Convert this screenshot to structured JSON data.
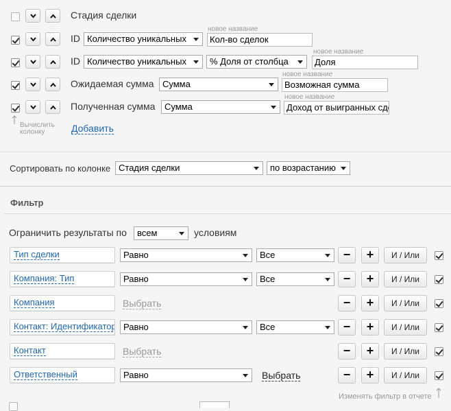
{
  "columns": {
    "rows": [
      {
        "checked": false,
        "label": "Стадия сделки"
      },
      {
        "checked": true,
        "label": "ID",
        "aggregate": "Количество уникальных",
        "hint": "новое название",
        "name": "Кол-во сделок"
      },
      {
        "checked": true,
        "label": "ID",
        "aggregate": "Количество уникальных",
        "extra": "% Доля от столбца",
        "hint": "новое название",
        "name": "Доля"
      },
      {
        "checked": true,
        "label": "Ожидаемая сумма",
        "aggregate": "Сумма",
        "hint": "новое название",
        "name": "Возможная сумма"
      },
      {
        "checked": true,
        "label": "Полученная сумма",
        "aggregate": "Сумма",
        "hint": "новое название",
        "name": "Доход от выигранных сделок"
      }
    ],
    "calc_hint_line1": "Вычислить",
    "calc_hint_line2": "колонку",
    "add_link": "Добавить"
  },
  "sort": {
    "label": "Сортировать по колонке",
    "column": "Стадия сделки",
    "order": "по возрастанию"
  },
  "filter": {
    "title": "Фильтр",
    "limit_label": "Ограничить результаты по",
    "limit_value": "всем",
    "limit_suffix": "условиям",
    "rows": [
      {
        "field": "Тип сделки",
        "op": "Равно",
        "value": "Все",
        "andor": "И / Или"
      },
      {
        "field": "Компания: Тип",
        "op": "Равно",
        "value": "Все",
        "andor": "И / Или"
      },
      {
        "field": "Компания",
        "choose": "Выбрать",
        "andor": "И / Или"
      },
      {
        "field": "Контакт: Идентификатор",
        "op": "Равно",
        "value": "Все",
        "andor": "И / Или"
      },
      {
        "field": "Контакт",
        "choose": "Выбрать",
        "andor": "И / Или"
      },
      {
        "field": "Ответственный",
        "op": "Равно",
        "choose": "Выбрать",
        "andor": "И / Или"
      }
    ],
    "minus": "−",
    "plus": "+",
    "change_hint": "Изменять фильтр в отчете"
  }
}
